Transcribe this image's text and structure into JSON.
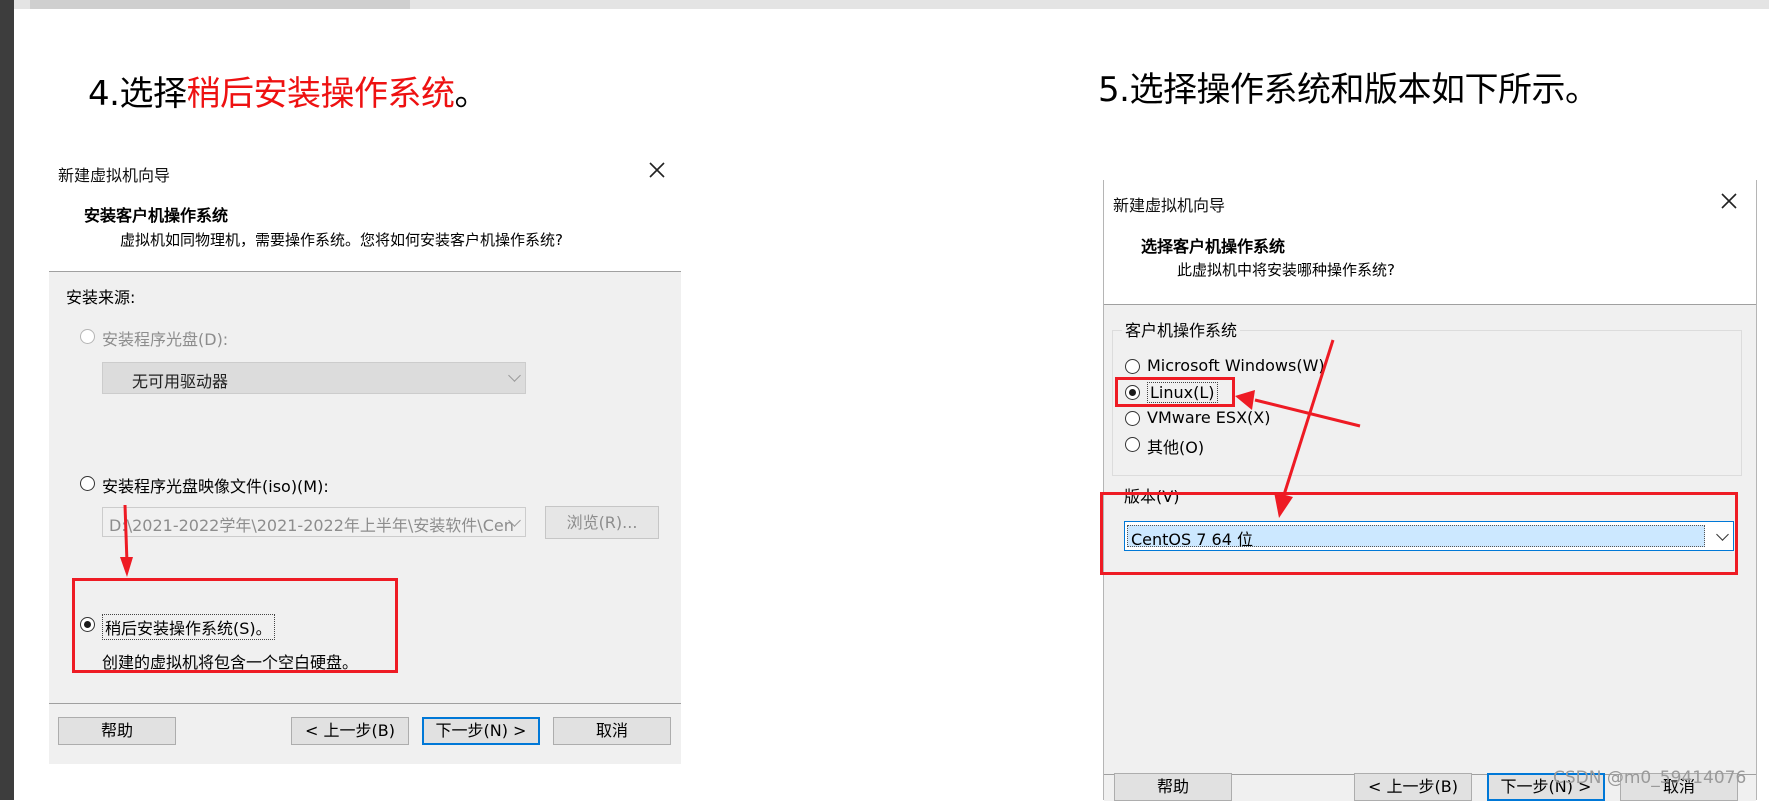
{
  "left_heading": {
    "prefix": "4.选择",
    "highlight": "稍后安装操作系统",
    "suffix": "。"
  },
  "right_heading": "5.选择操作系统和版本如下所示。",
  "dialog1": {
    "title": "新建虚拟机向导",
    "header_title": "安装客户机操作系统",
    "header_subtitle": "虚拟机如同物理机，需要操作系统。您将如何安装客户机操作系统?",
    "install_source_label": "安装来源:",
    "option_disc": "安装程序光盘(D):",
    "disc_drive_value": "无可用驱动器",
    "option_iso": "安装程序光盘映像文件(iso)(M):",
    "iso_path_value": "D:\\2021-2022学年\\2021-2022年上半年\\安装软件\\Cen",
    "browse_button": "浏览(R)...",
    "option_later": "稍后安装操作系统(S)。",
    "later_description": "创建的虚拟机将包含一个空白硬盘。",
    "help_button": "帮助",
    "back_button": "< 上一步(B)",
    "next_button": "下一步(N) >",
    "cancel_button": "取消",
    "selected_option": "later"
  },
  "dialog2": {
    "title": "新建虚拟机向导",
    "header_title": "选择客户机操作系统",
    "header_subtitle": "此虚拟机中将安装哪种操作系统?",
    "group_label": "客户机操作系统",
    "os_options": [
      "Microsoft Windows(W)",
      "Linux(L)",
      "VMware ESX(X)",
      "其他(O)"
    ],
    "selected_os": "Linux(L)",
    "version_label": "版本(V)",
    "version_value": "CentOS 7 64 位",
    "help_button": "帮助",
    "back_button": "< 上一步(B)",
    "next_button": "下一步(N) >",
    "cancel_button": "取消"
  },
  "watermark": "CSDN @m0_59414076",
  "colors": {
    "annotation_red": "#ee1b24",
    "heading_red": "#ee1111",
    "focus_blue": "#0078d7"
  }
}
